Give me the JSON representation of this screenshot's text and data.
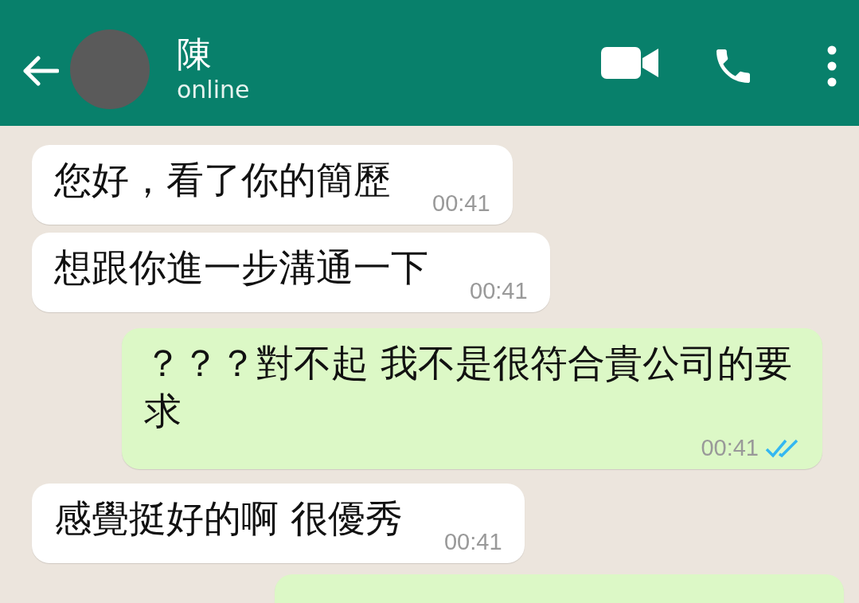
{
  "contact": {
    "name": "陳",
    "status": "online"
  },
  "messages": [
    {
      "kind": "incoming",
      "text": "您好，看了你的簡歷",
      "time": "00:41"
    },
    {
      "kind": "incoming",
      "text": "想跟你進一步溝通一下",
      "time": "00:41"
    },
    {
      "kind": "outgoing",
      "text": "？？？對不起 我不是很符合貴公司的要求",
      "time": "00:41",
      "read": true
    },
    {
      "kind": "incoming",
      "text": "感覺挺好的啊 很優秀",
      "time": "00:41"
    }
  ]
}
